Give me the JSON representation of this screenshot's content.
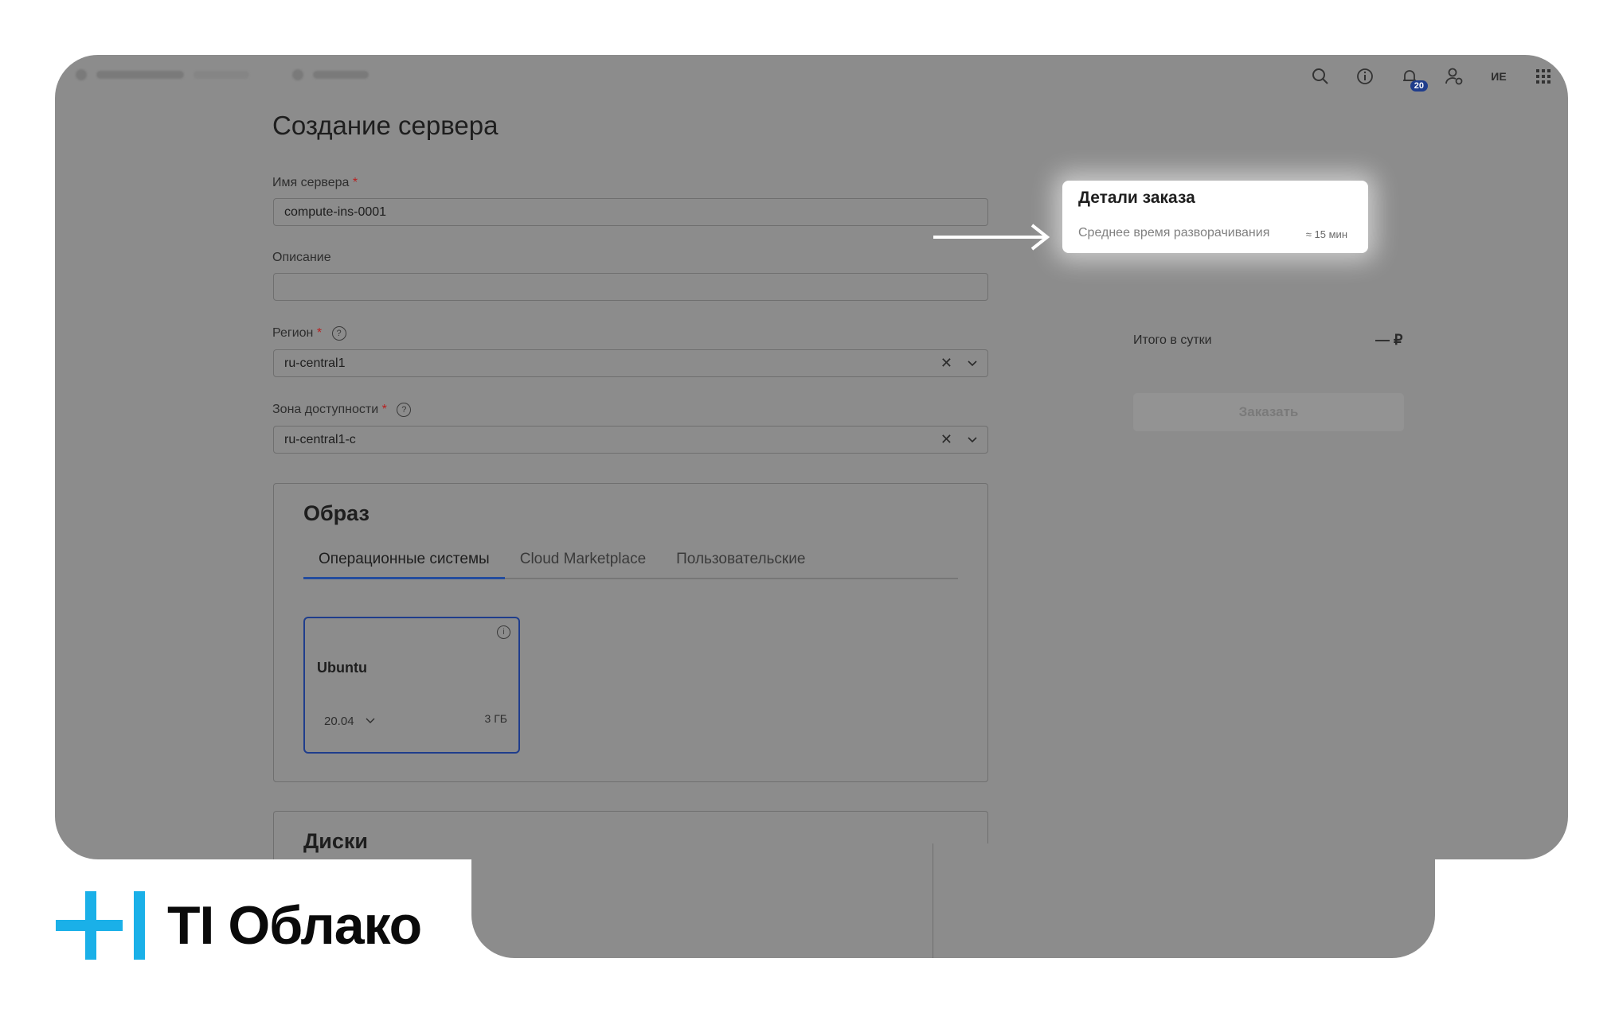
{
  "topbar": {
    "notifications_count": "20",
    "user_initials": "ИЕ"
  },
  "page": {
    "title": "Создание сервера"
  },
  "form": {
    "server_name": {
      "label": "Имя сервера",
      "required_mark": "*",
      "value": "compute-ins-0001"
    },
    "description": {
      "label": "Описание",
      "value": ""
    },
    "region": {
      "label": "Регион",
      "required_mark": "*",
      "help": "?",
      "value": "ru-central1"
    },
    "zone": {
      "label": "Зона доступности",
      "required_mark": "*",
      "help": "?",
      "value": "ru-central1-c"
    }
  },
  "image_section": {
    "title": "Образ",
    "tabs": [
      {
        "label": "Операционные системы",
        "active": true
      },
      {
        "label": "Cloud Marketplace",
        "active": false
      },
      {
        "label": "Пользовательские",
        "active": false
      }
    ],
    "card": {
      "name": "Ubuntu",
      "version": "20.04",
      "size": "3 ГБ",
      "info": "i"
    }
  },
  "disks_section": {
    "title": "Диски"
  },
  "order": {
    "title": "Детали заказа",
    "deploy_label": "Среднее время разворачивания",
    "deploy_time": "≈ 15 мин",
    "total_label": "Итого в сутки",
    "total_value": "— ₽",
    "submit_label": "Заказать"
  },
  "brand": {
    "name": "TI Облако",
    "accent_color": "#1ab0e8"
  },
  "icons": [
    "search-icon",
    "info-icon",
    "bell-icon",
    "user-settings-icon",
    "apps-grid-icon",
    "clear-icon",
    "chevron-down-icon",
    "help-icon",
    "arrow-right-icon"
  ]
}
